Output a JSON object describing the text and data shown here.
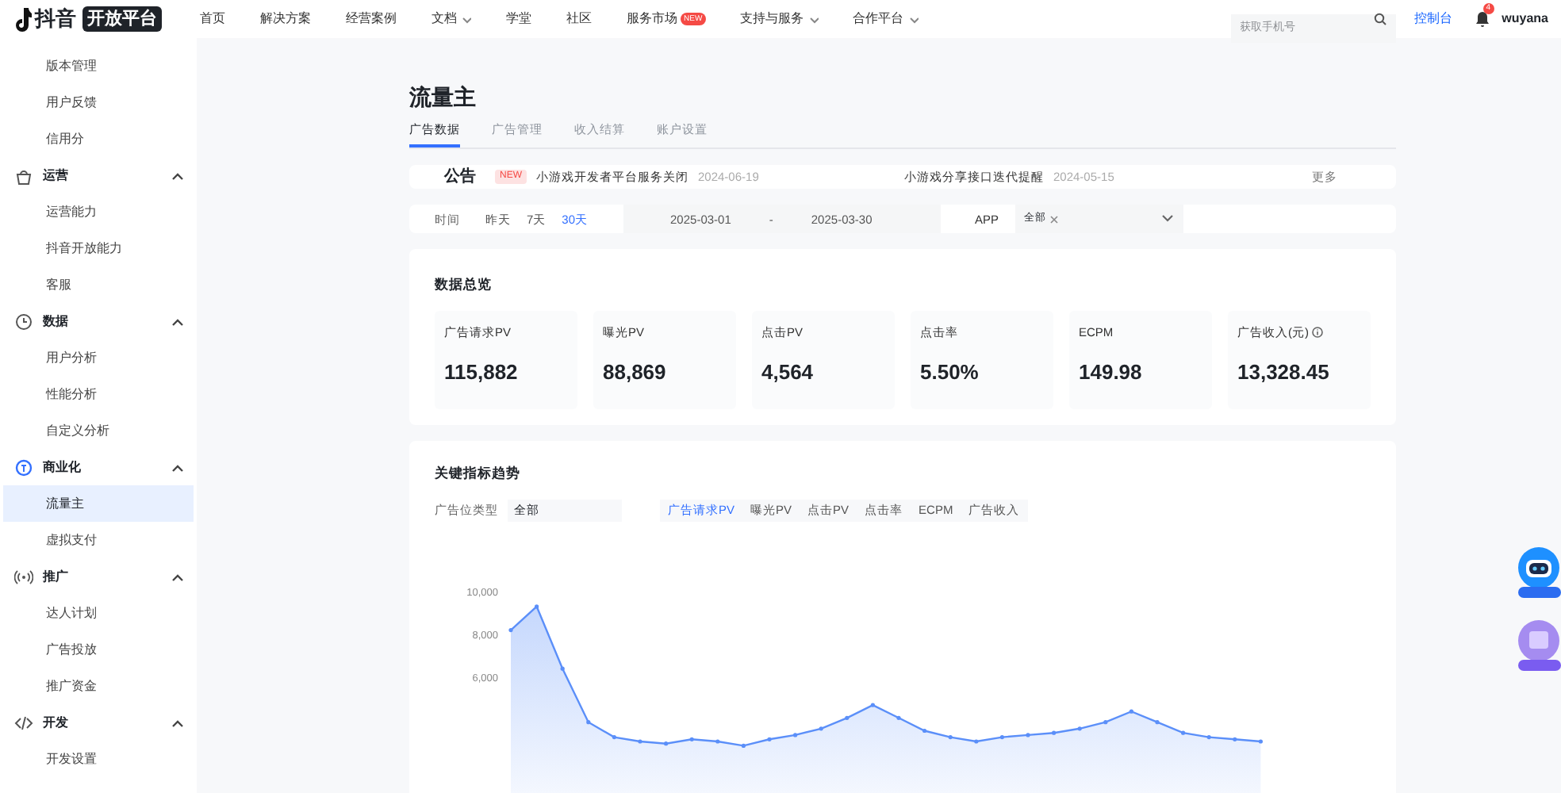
{
  "header": {
    "logo_text": "抖音",
    "logo_badge": "开放平台",
    "nav": [
      {
        "label": "首页",
        "dropdown": false
      },
      {
        "label": "解决方案",
        "dropdown": false
      },
      {
        "label": "经营案例",
        "dropdown": false
      },
      {
        "label": "文档",
        "dropdown": true
      },
      {
        "label": "学堂",
        "dropdown": false
      },
      {
        "label": "社区",
        "dropdown": false
      },
      {
        "label": "服务市场",
        "dropdown": false,
        "badge": "NEW"
      },
      {
        "label": "支持与服务",
        "dropdown": true
      },
      {
        "label": "合作平台",
        "dropdown": true
      }
    ],
    "search": {
      "placeholder": "获取手机号"
    },
    "console": "控制台",
    "notifications": "4",
    "user": "wuyana"
  },
  "sidebar": [
    {
      "kind": "item",
      "label": "版本管理",
      "selected": false
    },
    {
      "kind": "item",
      "label": "用户反馈",
      "selected": false
    },
    {
      "kind": "item",
      "label": "信用分",
      "selected": false
    },
    {
      "kind": "group",
      "label": "运营",
      "expanded": true,
      "children": [
        {
          "label": "运营能力",
          "selected": false
        },
        {
          "label": "抖音开放能力",
          "selected": false
        },
        {
          "label": "客服",
          "selected": false
        }
      ]
    },
    {
      "kind": "group",
      "label": "数据",
      "expanded": true,
      "children": [
        {
          "label": "用户分析",
          "selected": false
        },
        {
          "label": "性能分析",
          "selected": false
        },
        {
          "label": "自定义分析",
          "selected": false
        }
      ]
    },
    {
      "kind": "group",
      "label": "商业化",
      "expanded": true,
      "children": [
        {
          "label": "流量主",
          "selected": true
        },
        {
          "label": "虚拟支付",
          "selected": false
        }
      ]
    },
    {
      "kind": "group",
      "label": "推广",
      "expanded": true,
      "children": [
        {
          "label": "达人计划",
          "selected": false
        },
        {
          "label": "广告投放",
          "selected": false
        },
        {
          "label": "推广资金",
          "selected": false
        }
      ]
    },
    {
      "kind": "group",
      "label": "开发",
      "expanded": true,
      "children": [
        {
          "label": "开发设置",
          "selected": false
        }
      ]
    }
  ],
  "page": {
    "title": "流量主",
    "tabs": [
      {
        "label": "广告数据",
        "selected": true
      },
      {
        "label": "广告管理",
        "selected": false
      },
      {
        "label": "收入结算",
        "selected": false
      },
      {
        "label": "账户设置",
        "selected": false
      }
    ],
    "announcement": {
      "label": "公告",
      "items": [
        {
          "badge": "NEW",
          "text": "小游戏开发者平台服务关闭",
          "date": "2024-06-19"
        },
        {
          "text": "小游戏分享接口迭代提醒",
          "date": "2024-05-15"
        }
      ],
      "more": "更多"
    },
    "filters": {
      "time_label": "时间",
      "ranges": [
        {
          "label": "昨天",
          "selected": false
        },
        {
          "label": "7天",
          "selected": false
        },
        {
          "label": "30天",
          "selected": true
        }
      ],
      "start": "2025-03-01",
      "separator": "-",
      "end": "2025-03-30",
      "app_label": "APP",
      "app_tag": "全部"
    },
    "overview": {
      "title": "数据总览",
      "metrics": [
        {
          "label": "广告请求PV",
          "value": "115,882",
          "info": false
        },
        {
          "label": "曝光PV",
          "value": "88,869",
          "info": false
        },
        {
          "label": "点击PV",
          "value": "4,564",
          "info": false
        },
        {
          "label": "点击率",
          "value": "5.50%",
          "info": false
        },
        {
          "label": "ECPM",
          "value": "149.98",
          "info": false
        },
        {
          "label": "广告收入(元)",
          "value": "13,328.45",
          "info": true
        }
      ]
    },
    "trend": {
      "title": "关键指标趋势",
      "slot_label": "广告位类型",
      "slot_value": "全部",
      "metric_tabs": [
        {
          "label": "广告请求PV",
          "selected": true
        },
        {
          "label": "曝光PV",
          "selected": false
        },
        {
          "label": "点击PV",
          "selected": false
        },
        {
          "label": "点击率",
          "selected": false
        },
        {
          "label": "ECPM",
          "selected": false
        },
        {
          "label": "广告收入",
          "selected": false
        }
      ],
      "chart_data": {
        "type": "area",
        "ylim": [
          0,
          10000
        ],
        "yticks": [
          {
            "value": 6000,
            "label": "6,000"
          },
          {
            "value": 8000,
            "label": "8,000"
          },
          {
            "value": 10000,
            "label": "10,000"
          }
        ],
        "series": [
          {
            "color": "#5b8ff9",
            "values": [
              8200,
              9300,
              6400,
              3900,
              3200,
              3000,
              2900,
              3100,
              3000,
              2800,
              3100,
              3300,
              3600,
              4100,
              4700,
              4100,
              3500,
              3200,
              3000,
              3200,
              3300,
              3400,
              3600,
              3900,
              4400,
              3900,
              3400,
              3200,
              3100,
              3000
            ]
          }
        ]
      }
    }
  }
}
